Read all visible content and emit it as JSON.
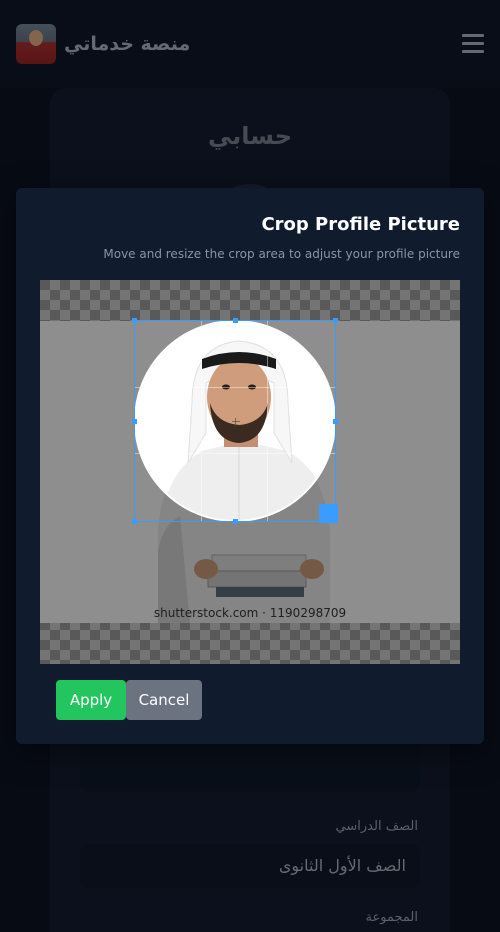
{
  "header": {
    "brand_name": "منصة خدماتي",
    "menu_icon": "hamburger-menu-icon"
  },
  "profile": {
    "title": "حسابي",
    "fields": [
      {
        "label": "الصف الدراسي",
        "value": "الصف الأول الثانوى"
      },
      {
        "label": "المجموعة",
        "value": ""
      }
    ]
  },
  "crop_modal": {
    "title": "Crop Profile Picture",
    "subtitle": "Move and resize the crop area to adjust your profile picture",
    "watermark": "shutterstock.com · 1190298709",
    "apply_label": "Apply",
    "cancel_label": "Cancel",
    "colors": {
      "handle": "#3b9cff",
      "apply": "#22c55e",
      "cancel": "#6b7280"
    }
  }
}
